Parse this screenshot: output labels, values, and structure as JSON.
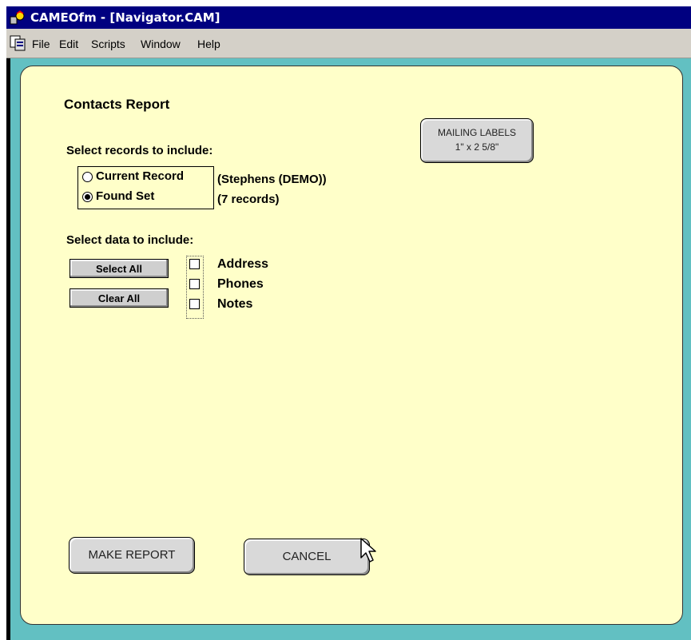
{
  "window": {
    "title": "CAMEOfm - [Navigator.CAM]"
  },
  "menu": {
    "items": [
      "File",
      "Edit",
      "Scripts",
      "Window",
      "Help"
    ]
  },
  "form": {
    "heading": "Contacts Report",
    "select_records_label": "Select records to include:",
    "records": [
      {
        "label": "Current Record",
        "detail": "(Stephens (DEMO))",
        "selected": false
      },
      {
        "label": "Found Set",
        "detail": "(7 records)",
        "selected": true
      }
    ],
    "select_data_label": "Select data to include:",
    "select_all_label": "Select All",
    "clear_all_label": "Clear All",
    "data_options": [
      {
        "label": "Address",
        "checked": false
      },
      {
        "label": "Phones",
        "checked": false
      },
      {
        "label": "Notes",
        "checked": false
      }
    ],
    "mailing_labels": {
      "line1": "MAILING LABELS",
      "line2": "1\" x 2 5/8\""
    },
    "make_report_label": "MAKE REPORT",
    "cancel_label": "CANCEL"
  },
  "colors": {
    "title_bar": "#000080",
    "background": "#62c0c2",
    "panel": "#ffffc9",
    "button": "#d9d9d9"
  }
}
